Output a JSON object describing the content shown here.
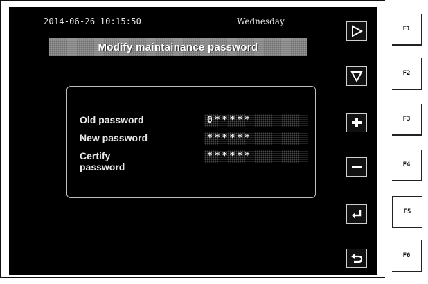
{
  "status_bar": {
    "datetime": "2014-06-26 10:15:50",
    "weekday": "Wednesday"
  },
  "title": "Modify maintainance password",
  "form": {
    "rows": [
      {
        "label": "Old password",
        "value": "0*****"
      },
      {
        "label": "New password",
        "value": "******"
      },
      {
        "label": "Certify password",
        "value": "******"
      }
    ]
  },
  "side_icons": [
    "play-right-icon",
    "triangle-down-icon",
    "plus-icon",
    "minus-icon",
    "enter-icon",
    "back-icon"
  ],
  "fkeys": [
    "F1",
    "F2",
    "F3",
    "F4",
    "F5",
    "F6"
  ],
  "colors": {
    "screen_bg": "#000000",
    "title_bg": "#9d9d9d",
    "text": "#e8e8e8"
  }
}
